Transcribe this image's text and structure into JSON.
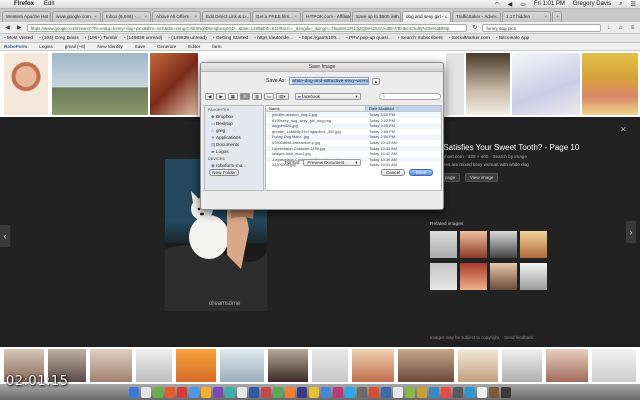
{
  "menubar": {
    "app_name": "Firefox",
    "menu_edit": "Edit",
    "clock": "Fri 1:01 PM",
    "user": "Gregory Davis"
  },
  "tabs": [
    {
      "label": "Western Apache Hot Sh..."
    },
    {
      "label": "www.google.com"
    },
    {
      "label": "Inbox (6,046) - ..."
    },
    {
      "label": "Above All Offers"
    },
    {
      "label": "Edit Direct Link & L..."
    },
    {
      "label": "Get a FREE film..."
    },
    {
      "label": "HITPOK.com - Affiliate"
    },
    {
      "label": "Save up to $500 with..."
    },
    {
      "label": "dog and sexy girl - ...",
      "active": true
    },
    {
      "label": "TrafficBaker - Adve..."
    },
    {
      "label": "1.17 hidden"
    }
  ],
  "navbar": {
    "url": "https://www.google.com/search?hl=en&q=funny+dog+pics&tbm=isch&tbs=simg:CAESNgllDkmqbAsyIGD...&biw=1280&bih=611#facrc=_&imgdii=_&imgrc=Tkqm9CzR1JjZQM%253A%3BAYBH5mC3o8yNGM%3Bhttp",
    "search_query": "funny dog pics"
  },
  "bookmarks": [
    "Most Visited",
    "(194) Greg Davis",
    "(196+) Tumblr",
    "(149838 unread)",
    "(149839 unread)",
    "Getting Started",
    "https://autoride...",
    "https://gaots109...",
    "PPV pop-up quasi...",
    "Search Subscribers",
    "SocialMarker.com",
    "Bitcoinalo App"
  ],
  "extbar": {
    "brand": "RoboForm",
    "logins": "Logins",
    "gmail": "gmail (+6)",
    "new_identity": "New Identity",
    "save": "Save",
    "generate": "Generate",
    "editor": "Editor",
    "farm": "farm"
  },
  "viewer": {
    "title": "hat Satisfies Your Sweet Tooth? - Page 10",
    "meta": "r.mulahhost.com · 320 × 400 · Search by image",
    "sub": "r pooches are mixed sexy woman with white dog",
    "visit_page": "Visit page",
    "view_image": "View image",
    "related_label": "Related images",
    "feedback": "Images may be subject to copyright. · Send feedback",
    "watermark": "dreamstime"
  },
  "dialog": {
    "title": "Save Image",
    "save_as_label": "Save As:",
    "filename": "white-dog-and-attractive-sexy-woma",
    "folder": "facebook",
    "sidebar": {
      "favorites_heading": "FAVORITES",
      "favorites": [
        {
          "label": "Dropbox",
          "icon": "dropbox-icon"
        },
        {
          "label": "Desktop",
          "icon": "desktop-icon"
        },
        {
          "label": "greg",
          "icon": "home-icon"
        },
        {
          "label": "Applications",
          "icon": "applications-icon"
        },
        {
          "label": "Documents",
          "icon": "documents-icon"
        },
        {
          "label": "Logos",
          "icon": "folder-icon"
        }
      ],
      "devices_heading": "DEVICES",
      "devices": [
        {
          "label": "roboform-ma...",
          "icon": "disk-icon"
        }
      ]
    },
    "columns": {
      "name": "Name",
      "date": "Date Modified"
    },
    "files": [
      {
        "name": "jennifer-aniston_dog-1.jpg",
        "date": "Today 3:02 PM"
      },
      {
        "name": "6165sexy_dog_sexy_girl_dog.png",
        "date": "Today 3:02 PM"
      },
      {
        "name": "dogpen026.jpg",
        "date": "Today 3:00 PM"
      },
      {
        "name": "greatte_1486b5p11e7dgaptbx1_300.jpg",
        "date": "Today 2:58 PM"
      },
      {
        "name": "Funny Dog Mam...jpg",
        "date": "Today 2:54 PM"
      },
      {
        "name": "076008698-interactive-p.jpg",
        "date": "Today 10:43 AM"
      },
      {
        "name": "Leprechaun-Costume-1199.jpg",
        "date": "Today 10:43 AM"
      },
      {
        "name": "images-irish_woo1.jpg",
        "date": "Today 10:42 AM"
      },
      {
        "name": "-Leprechaun-Costu...ers-Sexxx-Leso.jpg",
        "date": "Today 10:39 AM"
      },
      {
        "name": "23205518.jpg",
        "date": "Today 10:31 AM"
      }
    ],
    "format_label": "Format:",
    "format_value": "Preview Document",
    "new_folder": "New Folder",
    "cancel": "Cancel",
    "save": "Save",
    "search_placeholder": ""
  },
  "overlay": {
    "timestamp": "02:01:15"
  }
}
